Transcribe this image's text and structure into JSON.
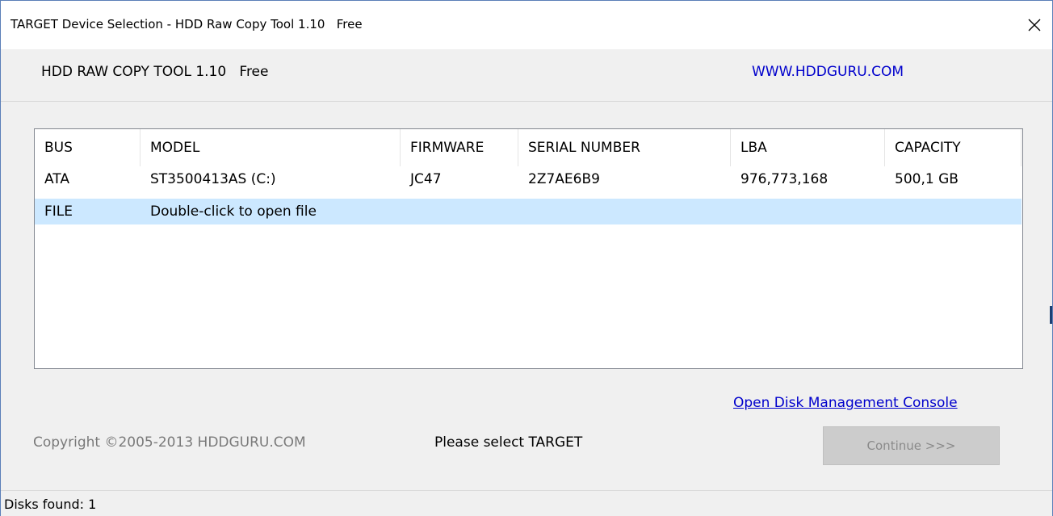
{
  "window": {
    "title": "TARGET Device Selection - HDD Raw Copy Tool 1.10   Free",
    "close_icon": "close-icon"
  },
  "header": {
    "app_name": "HDD RAW COPY TOOL 1.10   Free",
    "site_link": "WWW.HDDGURU.COM",
    "colors": {
      "link": "#0000cc"
    }
  },
  "device_list": {
    "columns": [
      "BUS",
      "MODEL",
      "FIRMWARE",
      "SERIAL NUMBER",
      "LBA",
      "CAPACITY"
    ],
    "rows": [
      {
        "bus": "ATA",
        "model": "ST3500413AS (C:)",
        "firmware": "JC47",
        "serial": "2Z7AE6B9",
        "lba": "976,773,168",
        "capacity": "500,1 GB",
        "selected": false
      },
      {
        "bus": "FILE",
        "model": "Double-click to open file",
        "firmware": "",
        "serial": "",
        "lba": "",
        "capacity": "",
        "selected": true
      }
    ],
    "colors": {
      "selected_row": "#cce8ff"
    }
  },
  "footer": {
    "disk_mgmt_link": "Open Disk Management Console",
    "copyright": "Copyright ©2005-2013 HDDGURU.COM",
    "status_message": "Please select TARGET",
    "continue_label": "Continue >>>"
  },
  "statusbar": {
    "text": "Disks found: 1"
  }
}
